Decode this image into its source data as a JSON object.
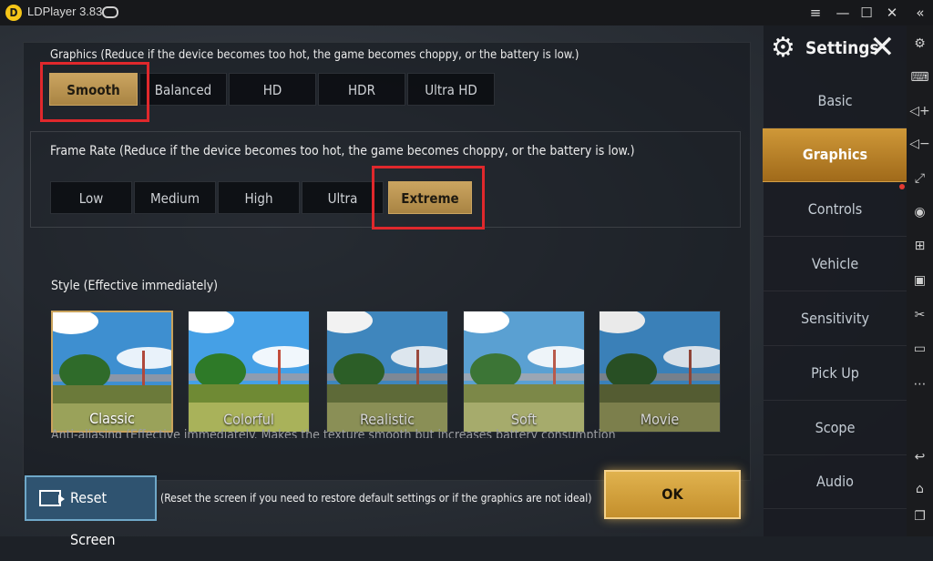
{
  "window": {
    "title": "LDPlayer 3.83",
    "logo_letter": "D",
    "buttons": [
      "≡",
      "—",
      "☐",
      "✕"
    ],
    "collapse": "«"
  },
  "graphics": {
    "label": "Graphics (Reduce if the device becomes too hot, the game becomes choppy, or the battery is low.)",
    "options": [
      "Smooth",
      "Balanced",
      "HD",
      "HDR",
      "Ultra HD"
    ],
    "selected": "Smooth"
  },
  "frame_rate": {
    "label": "Frame Rate (Reduce if the device becomes too hot, the game becomes choppy, or the battery is low.)",
    "options": [
      "Low",
      "Medium",
      "High",
      "Ultra",
      "Extreme"
    ],
    "selected": "Extreme"
  },
  "style": {
    "label": "Style (Effective immediately)",
    "options": [
      "Classic",
      "Colorful",
      "Realistic",
      "Soft",
      "Movie"
    ],
    "selected": "Classic"
  },
  "anti_aliasing_cutoff": "Anti-aliasing (Effective immediately. Makes the texture smooth but increases battery consumption.)",
  "reset": {
    "label": "Reset Screen",
    "note": "(Reset the screen if you need to restore default settings or if the graphics are not ideal)"
  },
  "ok_label": "OK",
  "sidebar": {
    "title": "Settings",
    "items": [
      "Basic",
      "Graphics",
      "Controls",
      "Vehicle",
      "Sensitivity",
      "Pick Up",
      "Scope",
      "Audio"
    ],
    "active": "Graphics"
  },
  "toolbar_icons": [
    "gear-icon",
    "keyboard-icon",
    "volume-up-icon",
    "volume-down-icon",
    "fullscreen-icon",
    "record-icon",
    "add-app-icon",
    "apk-icon",
    "scissors-icon",
    "video-icon",
    "more-icon",
    "back-icon",
    "home-icon",
    "recent-apps-icon"
  ],
  "colors": {
    "accent_gold": "#c9a25b",
    "highlight_red": "#e0282c",
    "reset_blue": "#2f5370"
  }
}
